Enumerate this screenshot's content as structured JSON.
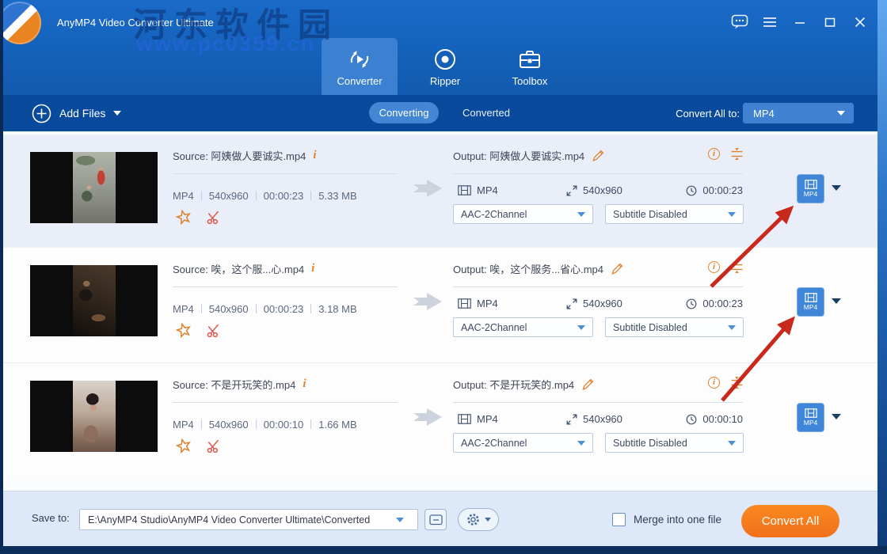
{
  "watermark": {
    "site_name": "河东软件园",
    "site_url": "www.pc0359.cn"
  },
  "titlebar": {
    "app_title": "AnyMP4 Video Converter Ultimate"
  },
  "nav": {
    "tabs": [
      {
        "label": "Converter"
      },
      {
        "label": "Ripper"
      },
      {
        "label": "Toolbox"
      }
    ]
  },
  "toolbar": {
    "add_files_label": "Add Files",
    "converting_label": "Converting",
    "converted_label": "Converted",
    "convert_all_to_label": "Convert All to:",
    "convert_all_to_value": "MP4"
  },
  "rows": [
    {
      "source_label": "Source: 阿姨做人要诚实.mp4",
      "src_format": "MP4",
      "src_resolution": "540x960",
      "src_duration": "00:00:23",
      "src_size": "5.33 MB",
      "output_label": "Output: 阿姨做人要诚实.mp4",
      "out_format": "MP4",
      "out_resolution": "540x960",
      "out_duration": "00:00:23",
      "audio_track": "AAC-2Channel",
      "subtitle": "Subtitle Disabled",
      "format_badge": "MP4"
    },
    {
      "source_label": "Source: 唉，这个服...心.mp4",
      "src_format": "MP4",
      "src_resolution": "540x960",
      "src_duration": "00:00:23",
      "src_size": "3.18 MB",
      "output_label": "Output: 唉，这个服务...省心.mp4",
      "out_format": "MP4",
      "out_resolution": "540x960",
      "out_duration": "00:00:23",
      "audio_track": "AAC-2Channel",
      "subtitle": "Subtitle Disabled",
      "format_badge": "MP4"
    },
    {
      "source_label": "Source: 不是开玩笑的.mp4",
      "src_format": "MP4",
      "src_resolution": "540x960",
      "src_duration": "00:00:10",
      "src_size": "1.66 MB",
      "output_label": "Output: 不是开玩笑的.mp4",
      "out_format": "MP4",
      "out_resolution": "540x960",
      "out_duration": "00:00:10",
      "audio_track": "AAC-2Channel",
      "subtitle": "Subtitle Disabled",
      "format_badge": "MP4"
    }
  ],
  "footer": {
    "save_to_label": "Save to:",
    "save_path": "E:\\AnyMP4 Studio\\AnyMP4 Video Converter Ultimate\\Converted",
    "merge_label": "Merge into one file",
    "convert_all_button": "Convert All"
  },
  "colors": {
    "header_blue": "#1563bd",
    "toolbar_blue": "#0a4a9d",
    "active_tab_blue": "#3c80d1",
    "selected_row": "#e9eef9",
    "accent_orange": "#f2771d",
    "annotation_red": "#c9281c"
  }
}
